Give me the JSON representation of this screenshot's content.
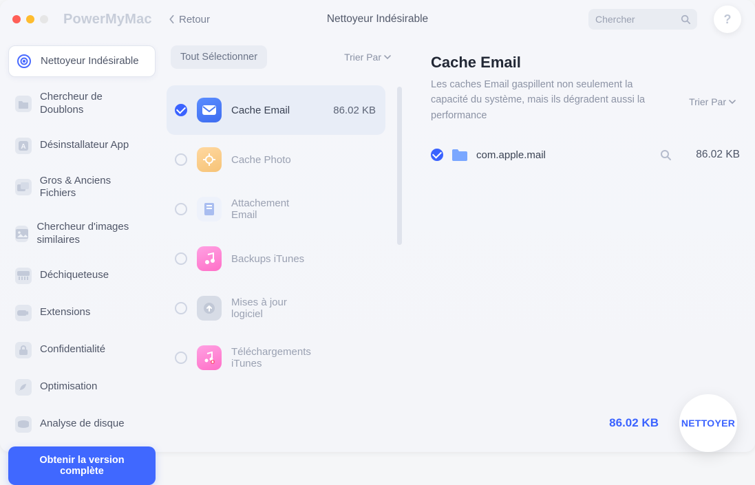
{
  "app": {
    "title": "PowerMyMac"
  },
  "header": {
    "back": "Retour",
    "page_title": "Nettoyeur Indésirable",
    "search_placeholder": "Chercher",
    "help": "?"
  },
  "sidebar": {
    "items": [
      {
        "label": "Nettoyeur Indésirable",
        "active": true
      },
      {
        "label": "Chercheur de Doublons",
        "active": false
      },
      {
        "label": "Désinstallateur App",
        "active": false
      },
      {
        "label": "Gros & Anciens Fichiers",
        "active": false
      },
      {
        "label": "Chercheur d'images similaires",
        "active": false
      },
      {
        "label": "Déchiqueteuse",
        "active": false
      },
      {
        "label": "Extensions",
        "active": false
      },
      {
        "label": "Confidentialité",
        "active": false
      },
      {
        "label": "Optimisation",
        "active": false
      },
      {
        "label": "Analyse de disque",
        "active": false
      }
    ],
    "upgrade": "Obtenir la version complète"
  },
  "middle": {
    "select_all": "Tout Sélectionner",
    "sort": "Trier Par",
    "categories": [
      {
        "label": "Cache Email",
        "size": "86.02 KB",
        "checked": true,
        "active": true,
        "color": "#3e73ff",
        "icon": "mail"
      },
      {
        "label": "Cache Photo",
        "size": "",
        "checked": false,
        "active": false,
        "color": "#f2c27a",
        "icon": "photo"
      },
      {
        "label": "Attachement Email",
        "size": "",
        "checked": false,
        "active": false,
        "color": "#9fb7ef",
        "icon": "attach"
      },
      {
        "label": "Backups iTunes",
        "size": "",
        "checked": false,
        "active": false,
        "color": "#ff74cf",
        "icon": "music"
      },
      {
        "label": "Mises à jour logiciel",
        "size": "",
        "checked": false,
        "active": false,
        "color": "#c8cfdc",
        "icon": "update"
      },
      {
        "label": "Téléchargements iTunes",
        "size": "",
        "checked": false,
        "active": false,
        "color": "#ff74cf",
        "icon": "music"
      }
    ]
  },
  "detail": {
    "title": "Cache Email",
    "description": "Les caches Email gaspillent non seulement la capacité du système, mais ils dégradent aussi la performance",
    "sort": "Trier Par",
    "files": [
      {
        "name": "com.apple.mail",
        "size": "86.02 KB",
        "checked": true
      }
    ]
  },
  "footer": {
    "total": "86.02 KB",
    "clean": "NETTOYER"
  }
}
